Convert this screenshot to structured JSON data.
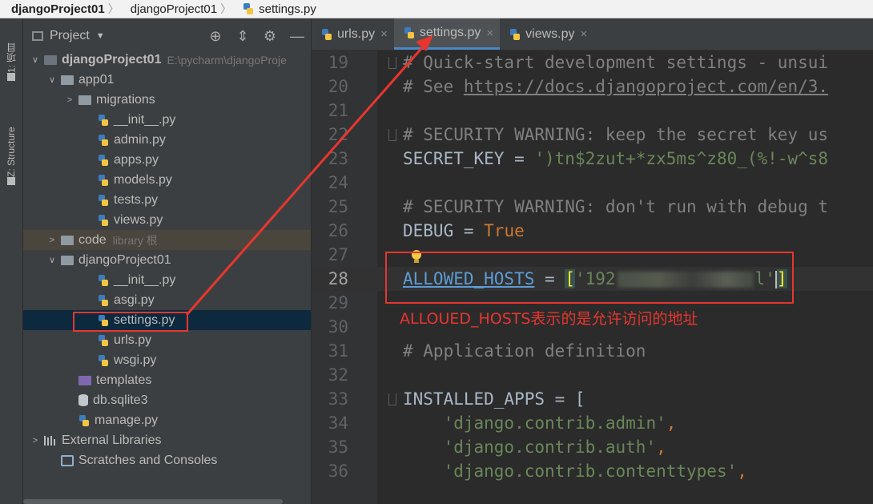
{
  "breadcrumbs": [
    {
      "label": "djangoProject01",
      "bold": true
    },
    {
      "label": "djangoProject01",
      "bold": false
    },
    {
      "label": "settings.py",
      "bold": false
    }
  ],
  "left_strip": {
    "project_tab": "1: 项目",
    "structure_tab": "Z: Structure"
  },
  "project_panel": {
    "title": "Project",
    "tree": [
      {
        "label": "djangoProject01",
        "extra": "E:\\pycharm\\djangoProje",
        "type": "root",
        "level": 0,
        "arrow": "down"
      },
      {
        "label": "app01",
        "type": "folder",
        "level": 1,
        "arrow": "down"
      },
      {
        "label": "migrations",
        "type": "folder",
        "level": 2,
        "arrow": "right"
      },
      {
        "label": "__init__.py",
        "type": "py",
        "level": 3
      },
      {
        "label": "admin.py",
        "type": "py",
        "level": 3
      },
      {
        "label": "apps.py",
        "type": "py",
        "level": 3
      },
      {
        "label": "models.py",
        "type": "py",
        "level": 3
      },
      {
        "label": "tests.py",
        "type": "py",
        "level": 3
      },
      {
        "label": "views.py",
        "type": "py",
        "level": 3
      },
      {
        "label": "code",
        "extra": "library 根",
        "type": "libfolder",
        "level": 1,
        "arrow": "right"
      },
      {
        "label": "djangoProject01",
        "type": "folder",
        "level": 1,
        "arrow": "down"
      },
      {
        "label": "__init__.py",
        "type": "py",
        "level": 3
      },
      {
        "label": "asgi.py",
        "type": "py",
        "level": 3
      },
      {
        "label": "settings.py",
        "type": "py",
        "level": 3,
        "selected": true
      },
      {
        "label": "urls.py",
        "type": "py",
        "level": 3
      },
      {
        "label": "wsgi.py",
        "type": "py",
        "level": 3
      },
      {
        "label": "templates",
        "type": "purplefolder",
        "level": 2
      },
      {
        "label": "db.sqlite3",
        "type": "db",
        "level": 2
      },
      {
        "label": "manage.py",
        "type": "py",
        "level": 2
      },
      {
        "label": "External Libraries",
        "type": "extlib",
        "level": 0,
        "arrow": "right"
      },
      {
        "label": "Scratches and Consoles",
        "type": "scratch",
        "level": 1
      }
    ]
  },
  "editor_tabs": [
    {
      "label": "urls.py",
      "active": false
    },
    {
      "label": "settings.py",
      "active": true
    },
    {
      "label": "views.py",
      "active": false
    }
  ],
  "code_lines": [
    {
      "num": "19",
      "fold": true,
      "segments": [
        {
          "t": "# Quick-start development settings - unsui",
          "c": "cm"
        }
      ]
    },
    {
      "num": "20",
      "segments": [
        {
          "t": "# See ",
          "c": "cm"
        },
        {
          "t": "https://docs.djangoproject.com/en/3.",
          "c": "cm-u"
        }
      ]
    },
    {
      "num": "21",
      "segments": []
    },
    {
      "num": "22",
      "fold": true,
      "segments": [
        {
          "t": "# SECURITY WARNING: keep the secret key us",
          "c": "cm"
        }
      ]
    },
    {
      "num": "23",
      "segments": [
        {
          "t": "SECRET_KEY",
          "c": "id"
        },
        {
          "t": " = ",
          "c": "id"
        },
        {
          "t": "')tn$2zut+*zx5ms^z80_(%!-w^s8",
          "c": "st"
        }
      ]
    },
    {
      "num": "24",
      "segments": []
    },
    {
      "num": "25",
      "segments": [
        {
          "t": "# SECURITY WARNING: don't run with debug t",
          "c": "cm"
        }
      ]
    },
    {
      "num": "26",
      "segments": [
        {
          "t": "DEBUG",
          "c": "id"
        },
        {
          "t": " = ",
          "c": "id"
        },
        {
          "t": "True",
          "c": "kw"
        }
      ]
    },
    {
      "num": "27",
      "segments": []
    },
    {
      "num": "28",
      "current": true,
      "segments": [
        {
          "t": "ALLOWED_HOSTS",
          "c": "link"
        },
        {
          "t": " = ",
          "c": "id"
        },
        {
          "t": "[",
          "c": "brk"
        },
        {
          "t": "'192",
          "c": "st"
        },
        {
          "t": "",
          "c": "blur"
        },
        {
          "t": "l'",
          "c": "st"
        },
        {
          "t": "",
          "c": "caret"
        },
        {
          "t": "]",
          "c": "brk"
        }
      ]
    },
    {
      "num": "29",
      "segments": []
    },
    {
      "num": "30",
      "segments": []
    },
    {
      "num": "31",
      "segments": [
        {
          "t": "# Application definition",
          "c": "cm"
        }
      ]
    },
    {
      "num": "32",
      "segments": []
    },
    {
      "num": "33",
      "fold": true,
      "segments": [
        {
          "t": "INSTALLED_APPS = [",
          "c": "id"
        }
      ]
    },
    {
      "num": "34",
      "segments": [
        {
          "t": "    ",
          "c": "id"
        },
        {
          "t": "'django.contrib.admin'",
          "c": "st"
        },
        {
          "t": ",",
          "c": "kw"
        }
      ]
    },
    {
      "num": "35",
      "segments": [
        {
          "t": "    ",
          "c": "id"
        },
        {
          "t": "'django.contrib.auth'",
          "c": "st"
        },
        {
          "t": ",",
          "c": "kw"
        }
      ]
    },
    {
      "num": "36",
      "segments": [
        {
          "t": "    ",
          "c": "id"
        },
        {
          "t": "'django.contrib.contenttypes'",
          "c": "st"
        },
        {
          "t": ",",
          "c": "kw"
        }
      ]
    }
  ],
  "annotation": "ALLOUED_HOSTS表示的是允许访问的地址",
  "colors": {
    "annotation_red": "#e8362f",
    "selection": "#0d293e",
    "accent_tab": "#4a88c7"
  }
}
